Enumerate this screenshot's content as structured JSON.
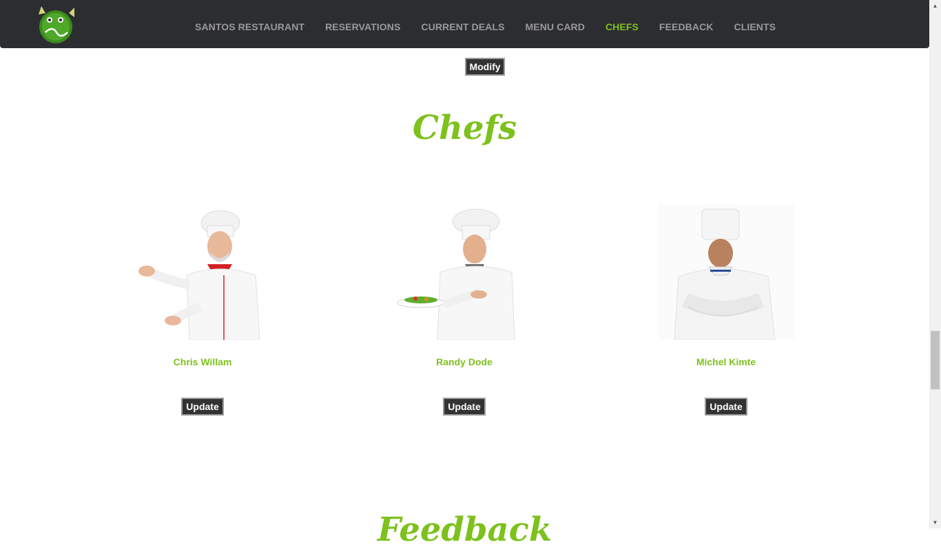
{
  "nav": {
    "items": [
      {
        "label": "SANTOS RESTAURANT",
        "active": false
      },
      {
        "label": "RESERVATIONS",
        "active": false
      },
      {
        "label": "CURRENT DEALS",
        "active": false
      },
      {
        "label": "MENU CARD",
        "active": false
      },
      {
        "label": "CHEFS",
        "active": true
      },
      {
        "label": "FEEDBACK",
        "active": false
      },
      {
        "label": "CLIENTS",
        "active": false
      }
    ],
    "accent_color": "#7dc11c",
    "bg_color": "#2b2d31"
  },
  "top_button": {
    "label": "Modify"
  },
  "chefs_section": {
    "title": "Chefs",
    "chefs": [
      {
        "name": "Chris Willam",
        "button": "Update",
        "icon": "chef-pointing-icon"
      },
      {
        "name": "Randy Dode",
        "button": "Update",
        "icon": "chef-with-plate-icon"
      },
      {
        "name": "Michel Kimte",
        "button": "Update",
        "icon": "chef-arms-crossed-icon"
      }
    ]
  },
  "feedback_section": {
    "title": "Feedback"
  }
}
